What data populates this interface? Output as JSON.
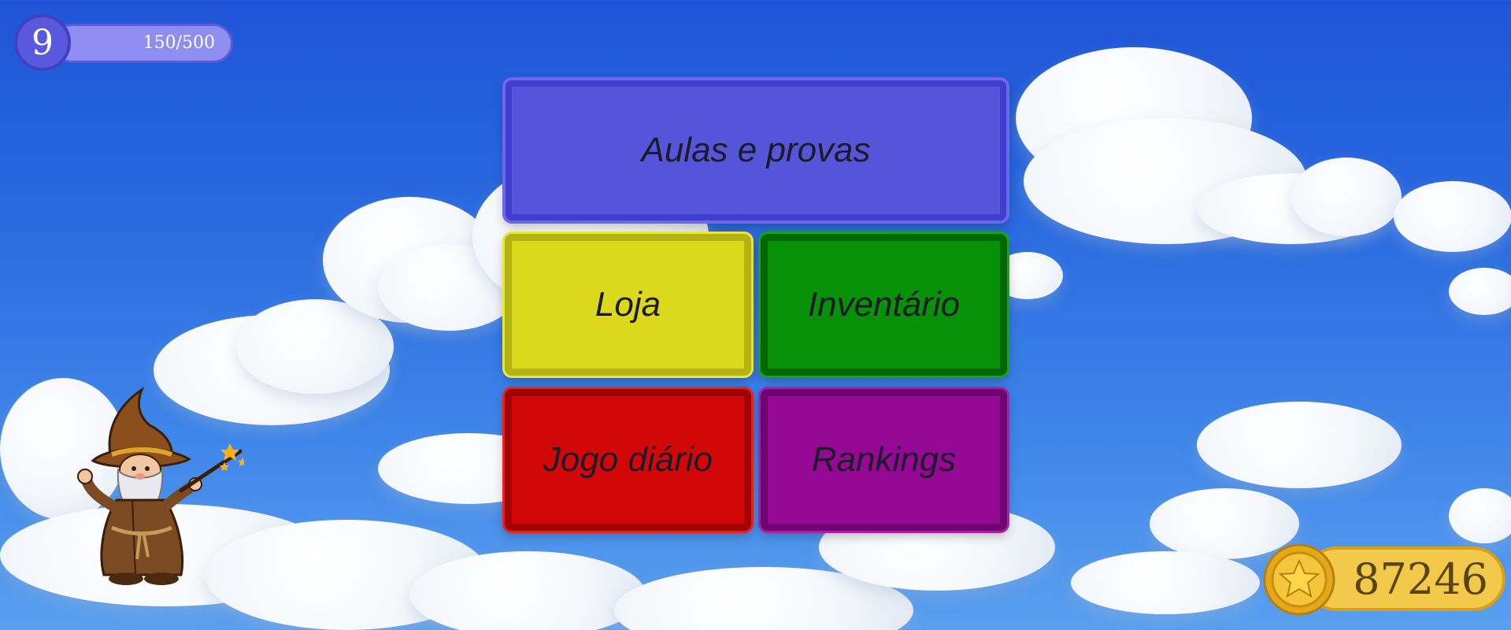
{
  "level": {
    "number": "9",
    "progress_text": "150/500",
    "progress_fraction": 0.3
  },
  "menu": {
    "aulas_label": "Aulas e provas",
    "loja_label": "Loja",
    "inventario_label": "Inventário",
    "jogo_label": "Jogo diário",
    "rankings_label": "Rankings"
  },
  "coins": {
    "value": "87246",
    "icon": "star-coin-icon"
  },
  "colors": {
    "aulas": "#5654d8",
    "loja": "#dcd91c",
    "inventario": "#079107",
    "jogo": "#d20808",
    "rankings": "#950894",
    "level_badge": "#5a58dc",
    "coin_bar": "#f2c94a"
  },
  "mascot": {
    "icon": "wizard-mascot-icon"
  }
}
